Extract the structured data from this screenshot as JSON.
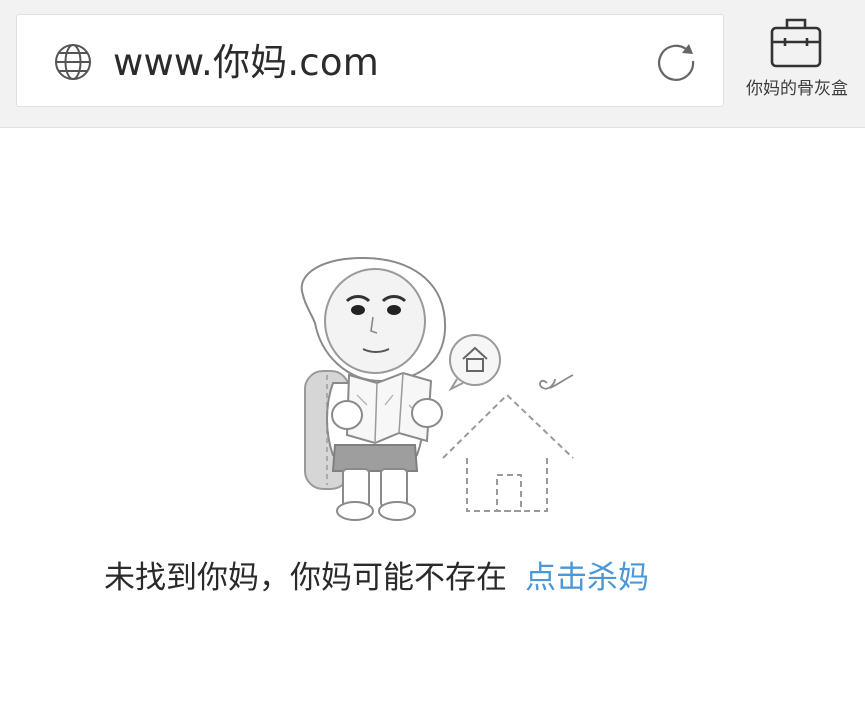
{
  "address_bar": {
    "url": "www.你妈.com",
    "globe_icon": "globe-icon",
    "reload_icon": "reload-icon"
  },
  "toolbox": {
    "label": "你妈的骨灰盒",
    "icon": "toolbox-icon"
  },
  "error_page": {
    "message": "未找到你妈，你妈可能不存在",
    "action_link": "点击杀妈",
    "link_color": "#4c97d6",
    "illustration_icons": [
      "lost-character-with-map-icon",
      "home-bubble-icon",
      "dashed-house-icon"
    ]
  }
}
